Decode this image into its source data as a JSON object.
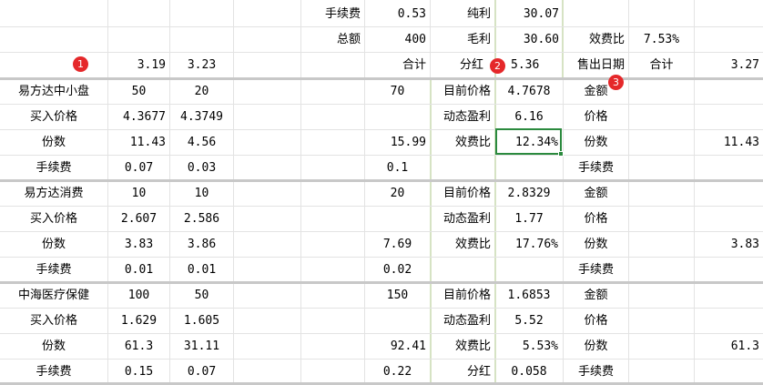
{
  "header": {
    "fee_label": "手续费",
    "fee_value": "0.53",
    "net_label": "纯利",
    "net_value": "30.07",
    "total_label": "总额",
    "total_value": "400",
    "gross_label": "毛利",
    "gross_value": "30.60",
    "ratio_label": "效费比",
    "ratio_value": "7.53%",
    "v1": "3.19",
    "v2": "3.23",
    "sum_label": "合计",
    "dividend_label": "分红",
    "dividend_value": "5.36",
    "sell_date_label": "售出日期",
    "sum_label2": "合计",
    "sum_value2": "3.27"
  },
  "markers": [
    "1",
    "2",
    "3"
  ],
  "funds": [
    {
      "name": "易方达中小盘",
      "a": "50",
      "b": "20",
      "total": "70",
      "price_label": "买入价格",
      "price_a": "4.3677",
      "price_b": "4.3749",
      "shares_label": "份数",
      "shares_a": "11.43",
      "shares_b": "4.56",
      "shares_total": "15.99",
      "fee_label": "手续费",
      "fee_a": "0.07",
      "fee_b": "0.03",
      "fee_total": "0.1",
      "cur_price_label": "目前价格",
      "cur_price": "4.7678",
      "dyn_label": "动态盈利",
      "dyn": "6.16",
      "ratio_label": "效费比",
      "ratio": "12.34%",
      "extra_label": "",
      "extra": "",
      "r_amount": "金额",
      "r_price": "价格",
      "r_shares": "份数",
      "r_fee": "手续费",
      "r_shares_value": "11.43"
    },
    {
      "name": "易方达消费",
      "a": "10",
      "b": "10",
      "total": "20",
      "price_label": "买入价格",
      "price_a": "2.607",
      "price_b": "2.586",
      "shares_label": "份数",
      "shares_a": "3.83",
      "shares_b": "3.86",
      "shares_total": "7.69",
      "fee_label": "手续费",
      "fee_a": "0.01",
      "fee_b": "0.01",
      "fee_total": "0.02",
      "cur_price_label": "目前价格",
      "cur_price": "2.8329",
      "dyn_label": "动态盈利",
      "dyn": "1.77",
      "ratio_label": "效费比",
      "ratio": "17.76%",
      "extra_label": "",
      "extra": "",
      "r_amount": "金额",
      "r_price": "价格",
      "r_shares": "份数",
      "r_fee": "手续费",
      "r_shares_value": "3.83"
    },
    {
      "name": "中海医疗保健",
      "a": "100",
      "b": "50",
      "total": "150",
      "price_label": "买入价格",
      "price_a": "1.629",
      "price_b": "1.605",
      "shares_label": "份数",
      "shares_a": "61.3",
      "shares_b": "31.11",
      "shares_total": "92.41",
      "fee_label": "手续费",
      "fee_a": "0.15",
      "fee_b": "0.07",
      "fee_total": "0.22",
      "cur_price_label": "目前价格",
      "cur_price": "1.6853",
      "dyn_label": "动态盈利",
      "dyn": "5.52",
      "ratio_label": "效费比",
      "ratio": "5.53%",
      "extra_label": "分红",
      "extra": "0.058",
      "r_amount": "金额",
      "r_price": "价格",
      "r_shares": "份数",
      "r_fee": "手续费",
      "r_shares_value": "61.3"
    }
  ]
}
